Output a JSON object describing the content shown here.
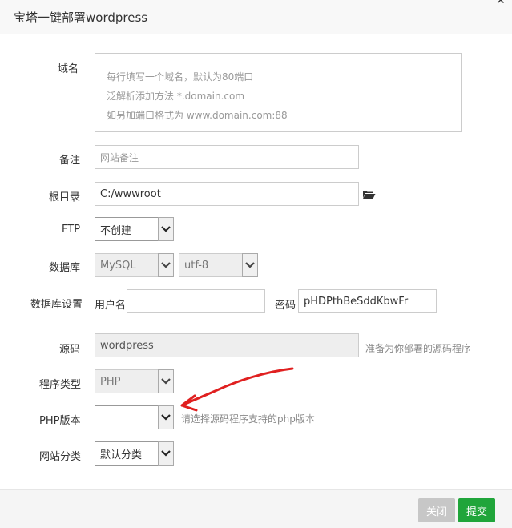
{
  "dialog": {
    "title": "宝塔一键部署wordpress"
  },
  "form": {
    "domain": {
      "label": "域名",
      "placeholder_lines": [
        "每行填写一个域名，默认为80端口",
        "泛解析添加方法 *.domain.com",
        "如另加端口格式为 www.domain.com:88"
      ]
    },
    "remark": {
      "label": "备注",
      "placeholder": "网站备注"
    },
    "root": {
      "label": "根目录",
      "value": "C:/wwwroot"
    },
    "ftp": {
      "label": "FTP",
      "value": "不创建"
    },
    "database": {
      "label": "数据库",
      "type": "MySQL",
      "charset": "utf-8"
    },
    "db_settings": {
      "label": "数据库设置",
      "user_label": "用户名",
      "user_value": "",
      "pass_label": "密码",
      "pass_value": "pHDPthBeSddKbwFr"
    },
    "source": {
      "label": "源码",
      "value": "wordpress",
      "hint": "准备为你部署的源码程序"
    },
    "program_type": {
      "label": "程序类型",
      "value": "PHP"
    },
    "php_version": {
      "label": "PHP版本",
      "value": "",
      "hint": "请选择源码程序支持的php版本"
    },
    "site_category": {
      "label": "网站分类",
      "value": "默认分类"
    }
  },
  "footer": {
    "close_label": "关闭",
    "submit_label": "提交"
  },
  "colors": {
    "submit": "#20a53a",
    "close": "#c7c7c7",
    "annotation_arrow": "#e02020"
  },
  "icons": {
    "folder": "folder-open-icon",
    "dialog_close": "close-icon"
  }
}
